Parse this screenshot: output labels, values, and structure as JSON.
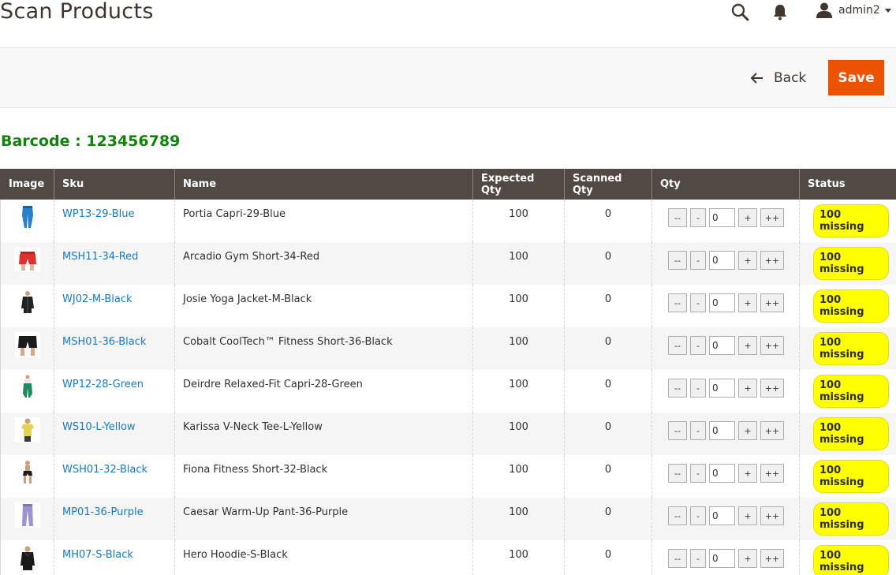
{
  "header": {
    "title": "Scan Products",
    "user_name": "admin2"
  },
  "actions": {
    "back_label": "Back",
    "save_label": "Save"
  },
  "barcode_label": "Barcode : 123456789",
  "table": {
    "columns": [
      "Image",
      "Sku",
      "Name",
      "Expected Qty",
      "Scanned Qty",
      "Qty",
      "Status"
    ],
    "qty_buttons": {
      "dec_all": "--",
      "dec": "-",
      "inc": "+",
      "inc_all": "++"
    },
    "rows": [
      {
        "sku": "WP13-29-Blue",
        "name": "Portia Capri-29-Blue",
        "expected": "100",
        "scanned": "0",
        "qty": "0",
        "status": "100 missing",
        "thumb": "capri-blue"
      },
      {
        "sku": "MSH11-34-Red",
        "name": "Arcadio Gym Short-34-Red",
        "expected": "100",
        "scanned": "0",
        "qty": "0",
        "status": "100 missing",
        "thumb": "shorts-red"
      },
      {
        "sku": "WJ02-M-Black",
        "name": "Josie Yoga Jacket-M-Black",
        "expected": "100",
        "scanned": "0",
        "qty": "0",
        "status": "100 missing",
        "thumb": "jacket-black"
      },
      {
        "sku": "MSH01-36-Black",
        "name": "Cobalt CoolTech™ Fitness Short-36-Black",
        "expected": "100",
        "scanned": "0",
        "qty": "0",
        "status": "100 missing",
        "thumb": "shorts-black"
      },
      {
        "sku": "WP12-28-Green",
        "name": "Deirdre Relaxed-Fit Capri-28-Green",
        "expected": "100",
        "scanned": "0",
        "qty": "0",
        "status": "100 missing",
        "thumb": "capri-green"
      },
      {
        "sku": "WS10-L-Yellow",
        "name": "Karissa V-Neck Tee-L-Yellow",
        "expected": "100",
        "scanned": "0",
        "qty": "0",
        "status": "100 missing",
        "thumb": "tee-yellow"
      },
      {
        "sku": "WSH01-32-Black",
        "name": "Fiona Fitness Short-32-Black",
        "expected": "100",
        "scanned": "0",
        "qty": "0",
        "status": "100 missing",
        "thumb": "shorts-woman-black"
      },
      {
        "sku": "MP01-36-Purple",
        "name": "Caesar Warm-Up Pant-36-Purple",
        "expected": "100",
        "scanned": "0",
        "qty": "0",
        "status": "100 missing",
        "thumb": "pants-purple"
      },
      {
        "sku": "MH07-S-Black",
        "name": "Hero Hoodie-S-Black",
        "expected": "100",
        "scanned": "0",
        "qty": "0",
        "status": "100 missing",
        "thumb": "hoodie-black"
      }
    ]
  },
  "colors": {
    "accent": "#eb5202",
    "header_bg": "#514943",
    "barcode_green": "#12820c",
    "link": "#1979c3",
    "status_bg": "#ffff00"
  }
}
